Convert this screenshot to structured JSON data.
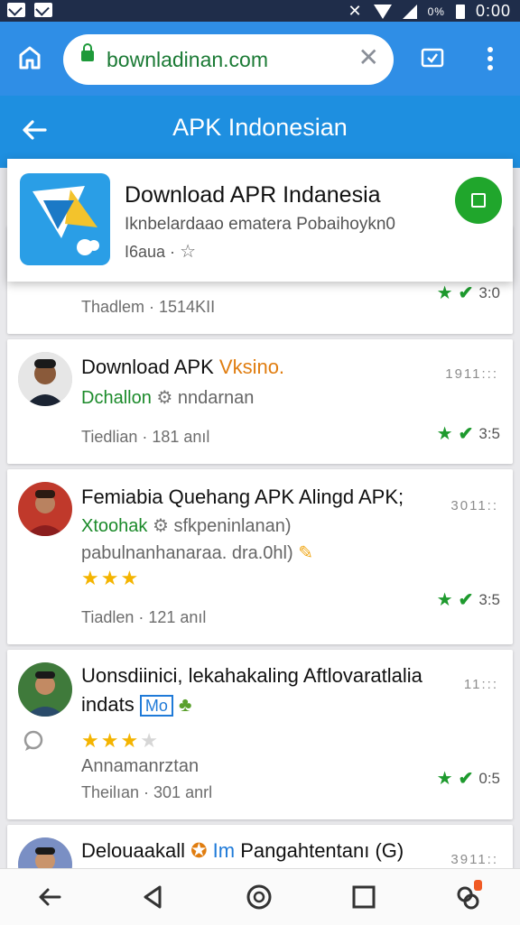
{
  "status": {
    "battery_pct": "0%",
    "time": "0:00"
  },
  "browser": {
    "url": "bownladinan.com"
  },
  "appbar": {
    "title": "APK Indonesian"
  },
  "featured": {
    "title": "Download APR Indanesia",
    "subtitle": "Iknbelardaao ematera Pobaihoykn0",
    "subtitle2": "I6aua ·"
  },
  "cards": [
    {
      "meta": "Thadlem · 1514KII",
      "rating": "3:0"
    },
    {
      "title_prefix": "Download APK",
      "title_suffix": "Vksino.",
      "sub_green": "Dchallon",
      "sub_gray": "nndarnan",
      "meta": "Tiedlian · 181 anıl",
      "time": "1911:::",
      "rating": "3:5"
    },
    {
      "title": "Femiabia Quehang APK Alingd APK;",
      "sub_green": "Xtoohak",
      "sub_gray": "sfkpeninlanan)",
      "line3": "pabulnanhanaraa. dra.0hl)",
      "meta": "Tiadlen · 121 anıl",
      "time": "3011::",
      "rating": "3:5",
      "stars": 3
    },
    {
      "title": "Uonsdiinici, lekahakaling Aftlovaratlalia",
      "title2": "indats",
      "badge": "Mo",
      "line3": "Annamanrztan",
      "meta": "Theilıan · 301 anrl",
      "time": "11:::",
      "rating": "0:5",
      "stars": 3
    },
    {
      "title_prefix": "Delouaakall",
      "title_mid": "Im",
      "title_suffix": "Pangahtentanı (G)",
      "time": "3911::"
    }
  ],
  "icons": {
    "nav": [
      "back-icon",
      "triangle-back-icon",
      "circle-home-icon",
      "square-recents-icon",
      "notification-icon"
    ]
  }
}
